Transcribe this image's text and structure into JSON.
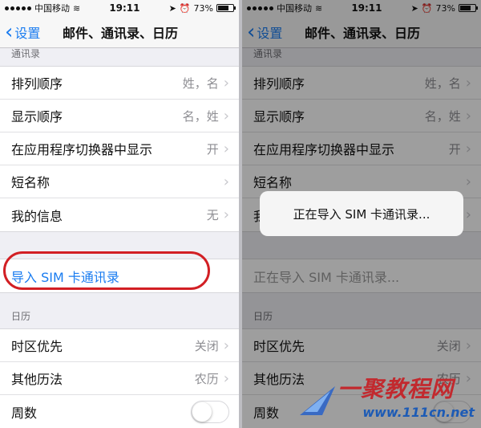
{
  "status": {
    "carrier": "中国移动",
    "time": "19:11",
    "battery": "73%",
    "battery_level": 0.73
  },
  "nav": {
    "back_label": "设置",
    "title": "邮件、通讯录、日历"
  },
  "contacts": {
    "section_header": "通讯录",
    "rows": [
      {
        "label": "排列顺序",
        "value": "姓，名"
      },
      {
        "label": "显示顺序",
        "value": "名，姓"
      },
      {
        "label": "在应用程序切换器中显示",
        "value": "开"
      },
      {
        "label": "短名称",
        "value": ""
      },
      {
        "label": "我的信息",
        "value": "无"
      }
    ]
  },
  "import_sim": {
    "label": "导入 SIM 卡通讯录",
    "label_disabled": "正在导入 SIM 卡通讯录..."
  },
  "calendar": {
    "section_header": "日历",
    "rows": [
      {
        "label": "时区优先",
        "value": "关闭"
      },
      {
        "label": "其他历法",
        "value": "农历"
      },
      {
        "label": "周数",
        "value": ""
      }
    ],
    "week_numbers_on": false
  },
  "dialog": {
    "message": "正在导入 SIM 卡通讯录..."
  },
  "watermark": {
    "title": "一聚教程网",
    "url": "www.111cn.net"
  },
  "colors": {
    "accent": "#1a7cf0",
    "highlight_ring": "#d21f24"
  }
}
